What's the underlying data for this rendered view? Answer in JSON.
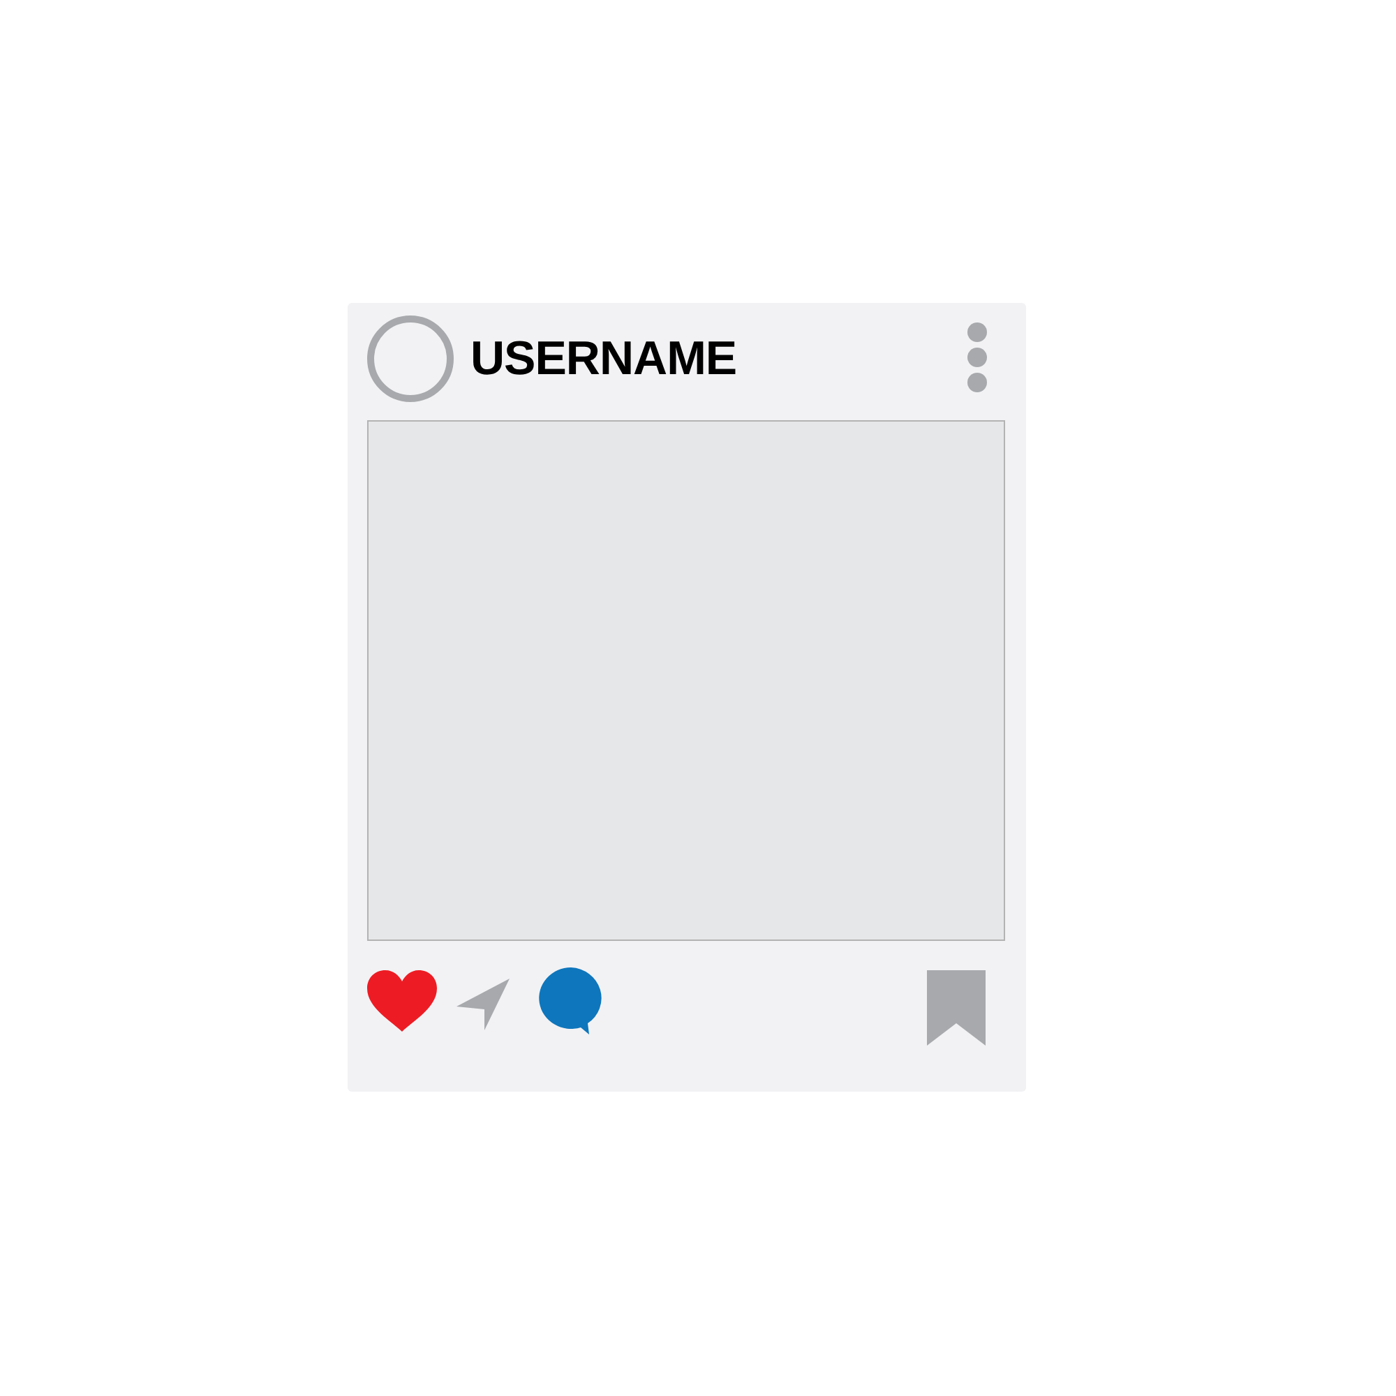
{
  "post": {
    "username": "USERNAME",
    "liked": true
  }
}
